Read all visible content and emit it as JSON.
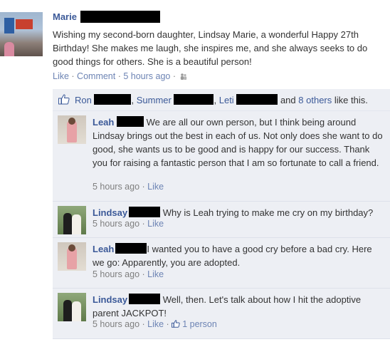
{
  "post": {
    "author": "Marie",
    "text": "Wishing my second-born daughter, Lindsay Marie, a wonderful Happy 27th Birthday! She makes me laugh, she inspires me, and she always seeks to do good things for others. She is a beautiful person!",
    "like_label": "Like",
    "comment_label": "Comment",
    "time": "5 hours ago",
    "sep": " · "
  },
  "likes": {
    "name1": "Ron",
    "name2": "Summer",
    "name3": "Leti",
    "comma": ",",
    "and_text": "and",
    "others_link": "8 others",
    "suffix": "like this."
  },
  "comments": [
    {
      "author": "Leah",
      "text": "We are all our own person, but I think being around Lindsay brings out the best in each of us. Not only does she want to do good, she wants us to be good and is happy for our success. Thank you for raising a fantastic person that I am so fortunate to call a friend.",
      "time": "5 hours ago",
      "like_label": "Like"
    },
    {
      "author": "Lindsay",
      "text": "Why is Leah trying to make me cry on my birthday?",
      "time": "5 hours ago",
      "like_label": "Like"
    },
    {
      "author": "Leah",
      "text": "I wanted you to have a good cry before a bad cry. Here we go: Apparently, you are adopted.",
      "time": "5 hours ago",
      "like_label": "Like"
    },
    {
      "author": "Lindsay",
      "text": "Well, then. Let's talk about how I hit the adoptive parent JACKPOT!",
      "time": "5 hours ago",
      "like_label": "Like",
      "likes_count": "1 person"
    }
  ],
  "colors": {
    "link": "#3b5998",
    "meta_link": "#6d84b4",
    "comment_bg": "#edeff4",
    "meta_text": "#7f7f7f"
  },
  "icons": {
    "friends": "friends-icon",
    "thumb": "thumbs-up-icon"
  }
}
